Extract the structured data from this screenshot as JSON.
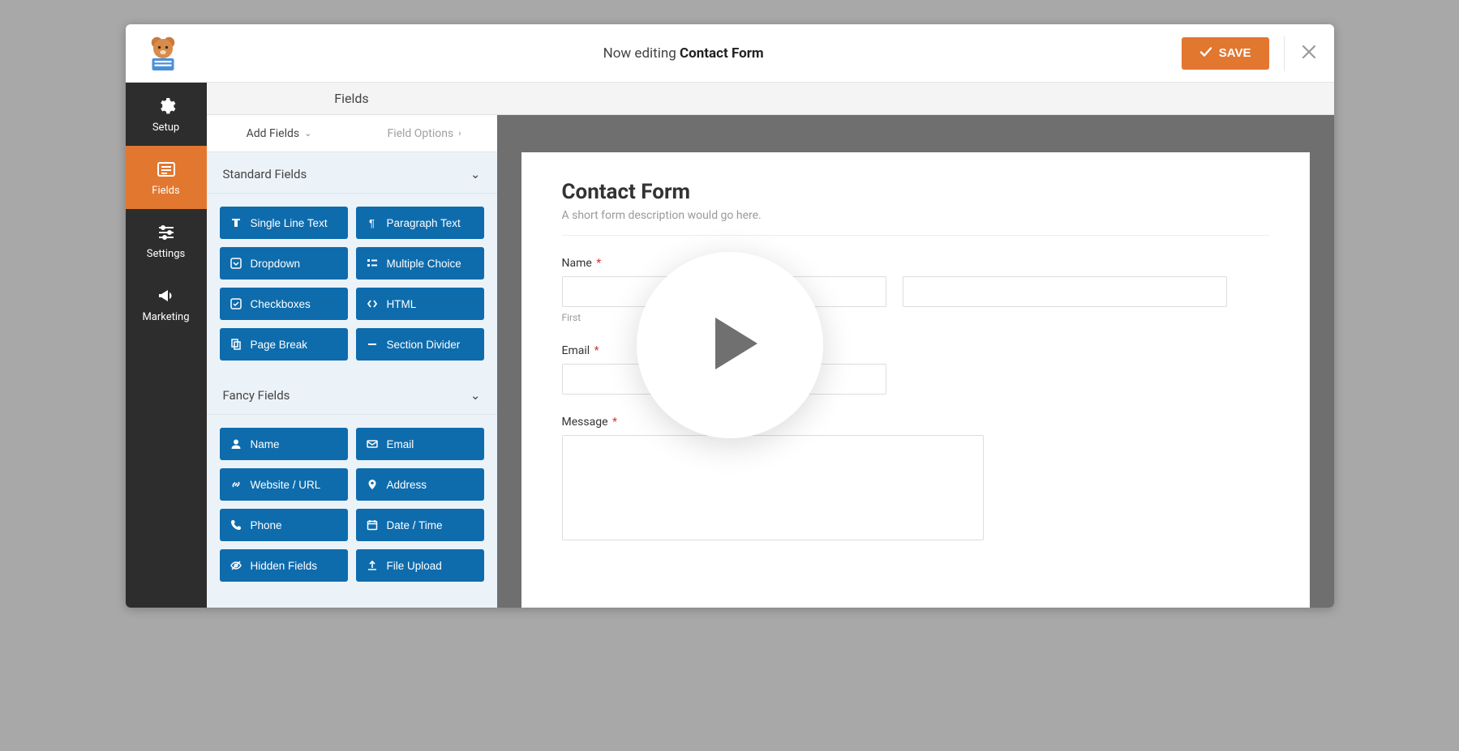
{
  "topbar": {
    "editing_prefix": "Now editing ",
    "form_name": "Contact Form",
    "save_label": "SAVE"
  },
  "leftnav": {
    "items": [
      {
        "key": "setup",
        "label": "Setup"
      },
      {
        "key": "fields",
        "label": "Fields"
      },
      {
        "key": "settings",
        "label": "Settings"
      },
      {
        "key": "marketing",
        "label": "Marketing"
      }
    ]
  },
  "section_header": "Fields",
  "tabs": {
    "add_fields": "Add Fields",
    "field_options": "Field Options"
  },
  "groups": {
    "standard": {
      "title": "Standard Fields",
      "items": [
        {
          "key": "single-line-text",
          "label": "Single Line Text"
        },
        {
          "key": "paragraph-text",
          "label": "Paragraph Text"
        },
        {
          "key": "dropdown",
          "label": "Dropdown"
        },
        {
          "key": "multiple-choice",
          "label": "Multiple Choice"
        },
        {
          "key": "checkboxes",
          "label": "Checkboxes"
        },
        {
          "key": "html",
          "label": "HTML"
        },
        {
          "key": "page-break",
          "label": "Page Break"
        },
        {
          "key": "section-divider",
          "label": "Section Divider"
        }
      ]
    },
    "fancy": {
      "title": "Fancy Fields",
      "items": [
        {
          "key": "name",
          "label": "Name"
        },
        {
          "key": "email",
          "label": "Email"
        },
        {
          "key": "website-url",
          "label": "Website / URL"
        },
        {
          "key": "address",
          "label": "Address"
        },
        {
          "key": "phone",
          "label": "Phone"
        },
        {
          "key": "date-time",
          "label": "Date / Time"
        },
        {
          "key": "hidden-fields",
          "label": "Hidden Fields"
        },
        {
          "key": "file-upload",
          "label": "File Upload"
        }
      ]
    }
  },
  "form": {
    "title": "Contact Form",
    "description": "A short form description would go here.",
    "name_label": "Name",
    "first_sublabel": "First",
    "email_label": "Email",
    "message_label": "Message",
    "required_marker": "*"
  }
}
